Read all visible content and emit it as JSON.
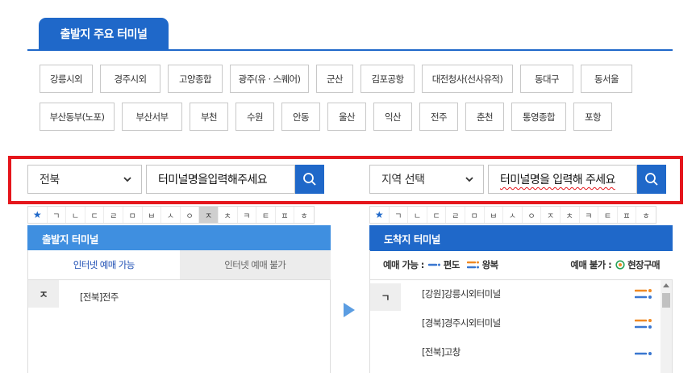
{
  "header": {
    "tab_title": "출발지 주요 터미널"
  },
  "main_terminals": {
    "row1": [
      "강릉시외",
      "경주시외",
      "고양종합",
      "광주(유 · 스퀘어)",
      "군산",
      "김포공항",
      "대전청사(선사유적)",
      "동대구",
      "동서울"
    ],
    "row2": [
      "부산동부(노포)",
      "부산서부",
      "부천",
      "수원",
      "안동",
      "울산",
      "익산",
      "전주",
      "춘천",
      "통영종합",
      "포항"
    ]
  },
  "departure": {
    "region_value": "전북",
    "input_value": "터미널명을입력해주세요",
    "panel_title": "출발지 터미널",
    "subtab_on": "인터넷 예매 가능",
    "subtab_off": "인터넷 예매 불가",
    "index": "ㅈ",
    "terminals": [
      "[전북]전주"
    ]
  },
  "arrival": {
    "region_value": "지역 선택",
    "input_value": "터미널명을 입력해 주세요",
    "panel_title": "도착지 터미널",
    "legend": {
      "possible_label": "예매 가능 :",
      "oneway_label": "편도",
      "round_label": "왕복",
      "impossible_label": "예매 불가 :",
      "onsite_label": "현장구매"
    },
    "index": "ㄱ",
    "terminals": [
      "[강원]강릉시외터미널",
      "[경북]경주시외터미널",
      "[전북]고창"
    ]
  },
  "consonants": [
    "★",
    "ㄱ",
    "ㄴ",
    "ㄷ",
    "ㄹ",
    "ㅁ",
    "ㅂ",
    "ㅅ",
    "ㅇ",
    "ㅈ",
    "ㅊ",
    "ㅋ",
    "ㅌ",
    "ㅍ",
    "ㅎ"
  ],
  "colors": {
    "primary": "#1f68c9",
    "header_light": "#3f8fe0",
    "highlight": "#e5161c",
    "oneway": "#3a77d0",
    "round": "#f08a24",
    "onsite": "#27a25a"
  }
}
